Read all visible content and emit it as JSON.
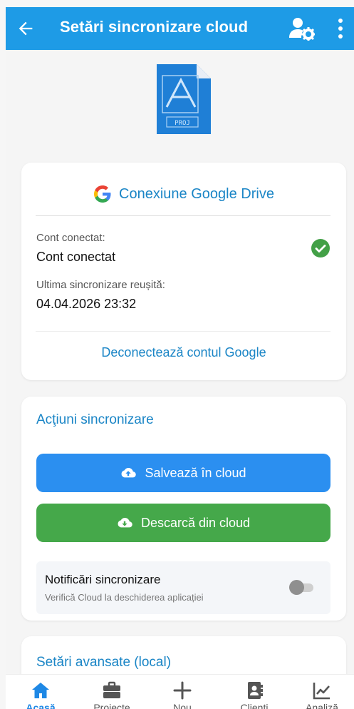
{
  "header": {
    "title": "Setări sincronizare cloud"
  },
  "gdrive": {
    "title": "Conexiune Google Drive",
    "account_label": "Cont conectat:",
    "account_value": "Cont conectat",
    "last_sync_label": "Ultima sincronizare reușită:",
    "last_sync_value": "04.04.2026 23:32",
    "disconnect_label": "Deconectează contul Google"
  },
  "sync_actions": {
    "title": "Acţiuni sincronizare",
    "save_label": "Salvează în cloud",
    "download_label": "Descarcă din cloud",
    "notifications": {
      "title": "Notificări sincronizare",
      "subtitle": "Verifică Cloud la deschiderea aplicației",
      "enabled": false
    }
  },
  "advanced": {
    "title": "Setări avansate (local)"
  },
  "nav": {
    "items": [
      {
        "label": "Acasă",
        "icon": "home-icon",
        "active": true
      },
      {
        "label": "Proiecte",
        "icon": "briefcase-icon",
        "active": false
      },
      {
        "label": "Nou",
        "icon": "plus-icon",
        "active": false
      },
      {
        "label": "Clienti",
        "icon": "contacts-icon",
        "active": false
      },
      {
        "label": "Analiză",
        "icon": "chart-icon",
        "active": false
      }
    ]
  },
  "colors": {
    "primary": "#1e9be6",
    "save": "#2b8ff0",
    "download": "#45a84a",
    "link": "#1a85c6"
  }
}
